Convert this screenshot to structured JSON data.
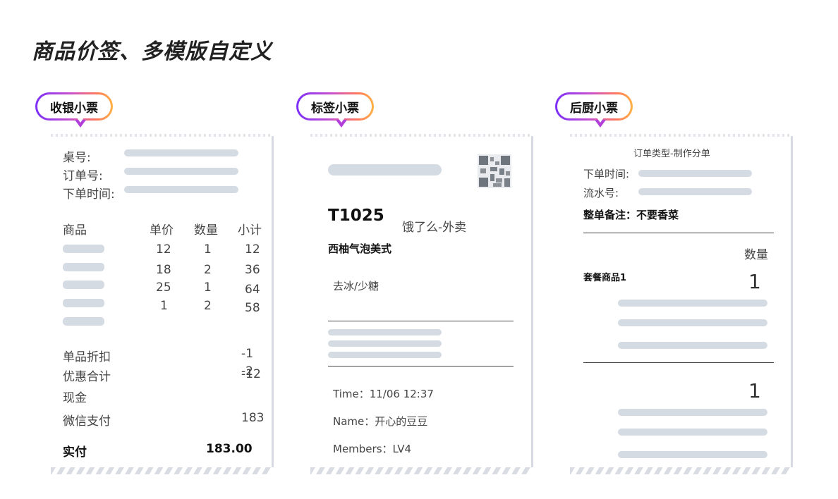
{
  "page_title": "商品价签、多模版自定义",
  "badges": {
    "cashier": "收银小票",
    "label": "标签小票",
    "kitchen": "后厨小票"
  },
  "cashier": {
    "field_table": "桌号:",
    "field_order": "订单号:",
    "field_time": "下单时间:",
    "col_product": "商品",
    "col_price": "单价",
    "col_qty": "数量",
    "col_subtotal": "小计",
    "rows": [
      {
        "price": "12",
        "qty": "1",
        "subtotal": "12"
      },
      {
        "price": "18",
        "qty": "2",
        "subtotal": "36"
      },
      {
        "price": "25",
        "qty": "1",
        "subtotal": "64"
      },
      {
        "price": "1",
        "qty": "2",
        "subtotal": "58"
      }
    ],
    "discount_label": "单品折扣",
    "discount_value": "-1",
    "promo_label": "优惠合计",
    "promo_value_a": "-2",
    "promo_value_b": "-12",
    "cash_label": "现金",
    "wechat_label": "微信支付",
    "wechat_value": "183",
    "paid_label": "实付",
    "paid_value": "183.00"
  },
  "label": {
    "code": "T1025",
    "channel": "饿了么-外卖",
    "product": "西柚气泡美式",
    "spec": "去冰/少糖",
    "time": "Time：11/06 12:37",
    "name": "Name：开心的豆豆",
    "member": "Members：LV4"
  },
  "kitchen": {
    "header": "订单类型-制作分单",
    "field_time": "下单时间:",
    "field_serial": "流水号:",
    "remark": "整单备注：不要香菜",
    "col_qty": "数量",
    "item1_name": "套餐商品1",
    "item1_qty": "1",
    "item2_qty": "1"
  }
}
